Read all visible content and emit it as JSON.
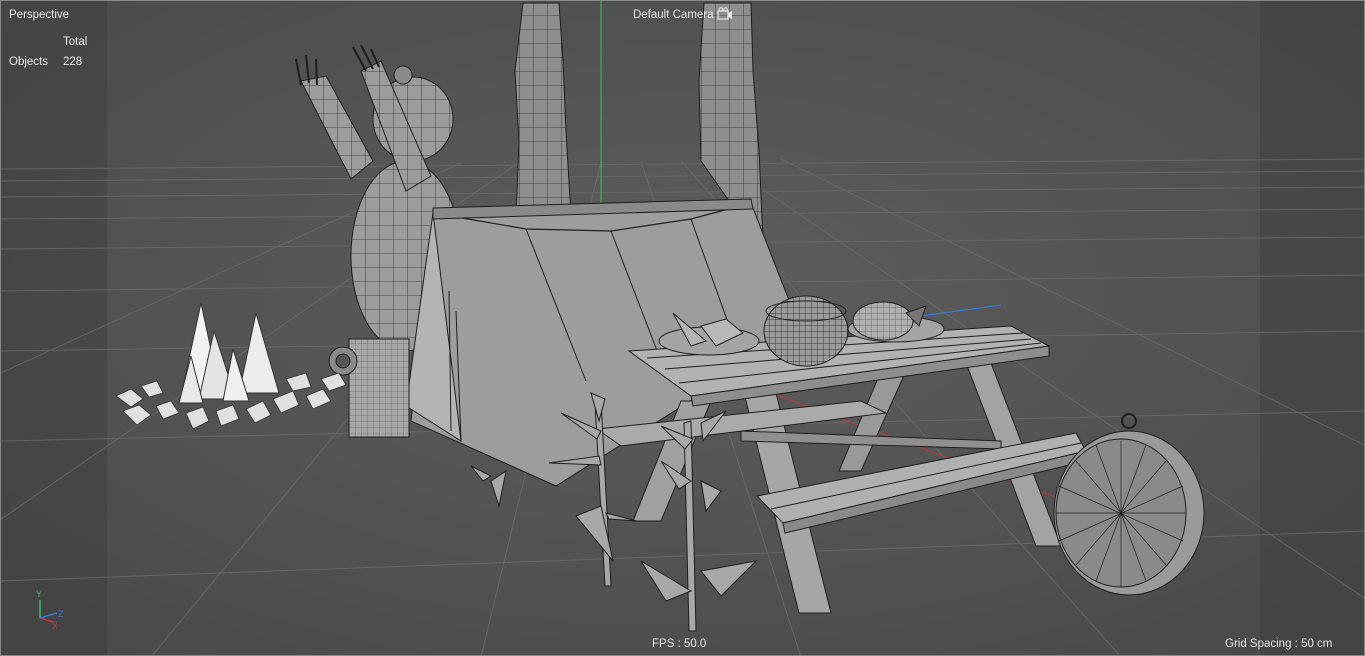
{
  "viewport": {
    "view_name": "Perspective",
    "camera_name": "Default Camera",
    "stats": {
      "column_header": "Total",
      "row_label": "Objects",
      "row_value": "228"
    },
    "fps_label": "FPS : 50.0",
    "grid_spacing_label": "Grid Spacing : 50 cm"
  },
  "axes": {
    "y": "Y",
    "x": "X",
    "z": "Z"
  },
  "colors": {
    "background": "#555555",
    "grid": "#6a6a6a",
    "mesh_fill": "#9a9a9a",
    "wire": "#1e1e1e",
    "x_axis": "#c23a3a",
    "y_axis": "#3fbf5f",
    "z_axis": "#3a7bd5"
  },
  "icons": [
    "camera-icon",
    "axis-gizmo-icon"
  ]
}
